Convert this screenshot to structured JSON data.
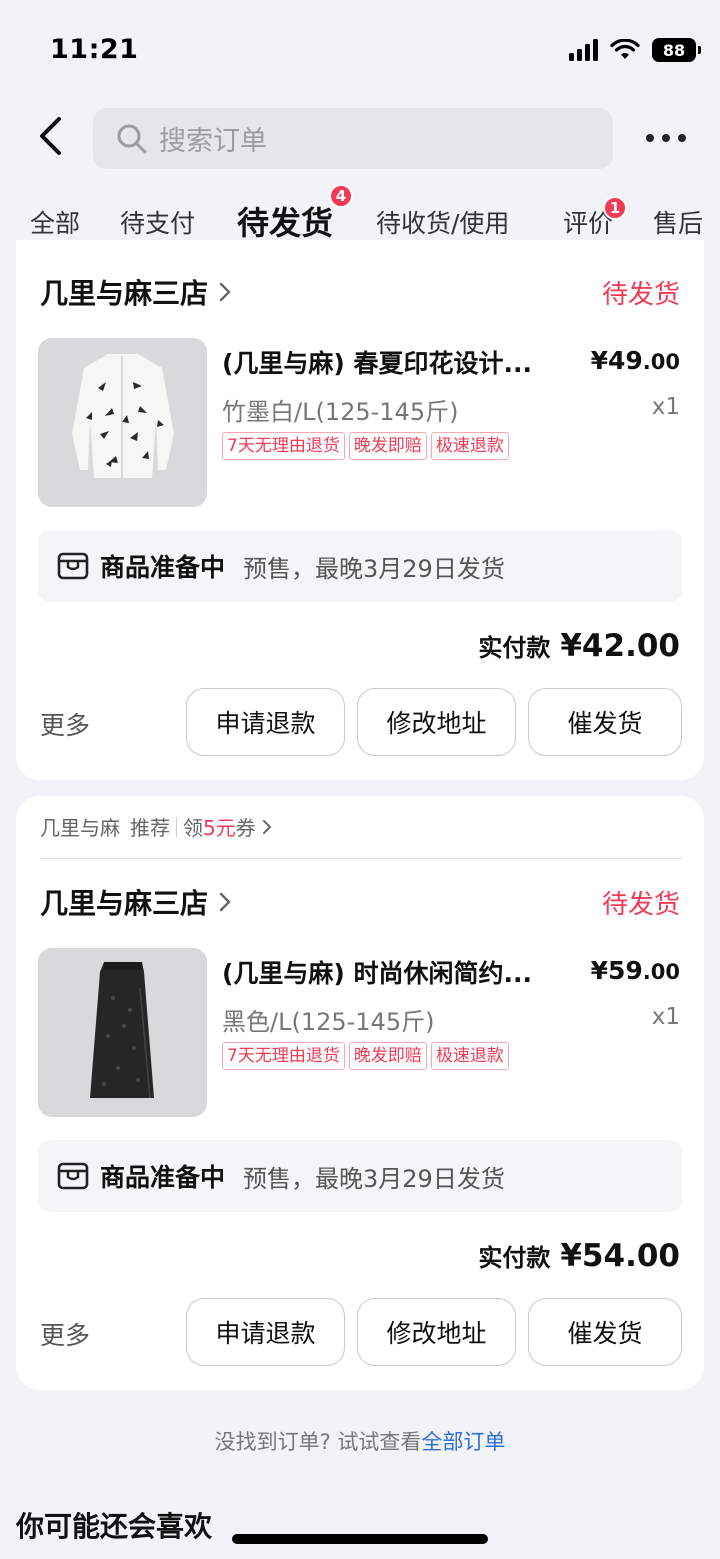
{
  "status_bar": {
    "time": "11:21",
    "battery": "88"
  },
  "header": {
    "search_placeholder": "搜索订单"
  },
  "tabs": [
    {
      "label": "全部",
      "badge": ""
    },
    {
      "label": "待支付",
      "badge": ""
    },
    {
      "label": "待发货",
      "badge": "4",
      "active": true
    },
    {
      "label": "待收货/使用",
      "badge": ""
    },
    {
      "label": "评价",
      "badge": "1"
    },
    {
      "label": "售后",
      "badge": ""
    }
  ],
  "orders": [
    {
      "shop": "几里与麻三店",
      "status": "待发货",
      "product_title": "(几里与麻) 春夏印花设计...",
      "price_main": "¥49",
      "price_decimal": ".00",
      "sku": "竹墨白/L(125-145斤)",
      "qty": "x1",
      "tags": [
        "7天无理由退货",
        "晚发即赔",
        "极速退款"
      ],
      "prep_title": "商品准备中",
      "prep_note": "预售，最晚3月29日发货",
      "paid_label": "实付款",
      "paid_amount": "¥42.00",
      "more": "更多",
      "buttons": [
        "申请退款",
        "修改地址",
        "催发货"
      ]
    },
    {
      "recommend": {
        "shop": "几里与麻",
        "label": "推荐",
        "coupon_prefix": "领",
        "coupon_value": "5元",
        "coupon_suffix": "券"
      },
      "shop": "几里与麻三店",
      "status": "待发货",
      "product_title": "(几里与麻) 时尚休闲简约...",
      "price_main": "¥59",
      "price_decimal": ".00",
      "sku": "黑色/L(125-145斤)",
      "qty": "x1",
      "tags": [
        "7天无理由退货",
        "晚发即赔",
        "极速退款"
      ],
      "prep_title": "商品准备中",
      "prep_note": "预售，最晚3月29日发货",
      "paid_label": "实付款",
      "paid_amount": "¥54.00",
      "more": "更多",
      "buttons": [
        "申请退款",
        "修改地址",
        "催发货"
      ]
    }
  ],
  "footer": {
    "not_found": "没找到订单? 试试查看",
    "all_orders_link": "全部订单",
    "guess_title": "你可能还会喜欢"
  },
  "colors": {
    "accent": "#f23b56",
    "link": "#2f6fd6",
    "background": "#f2f3f7"
  }
}
